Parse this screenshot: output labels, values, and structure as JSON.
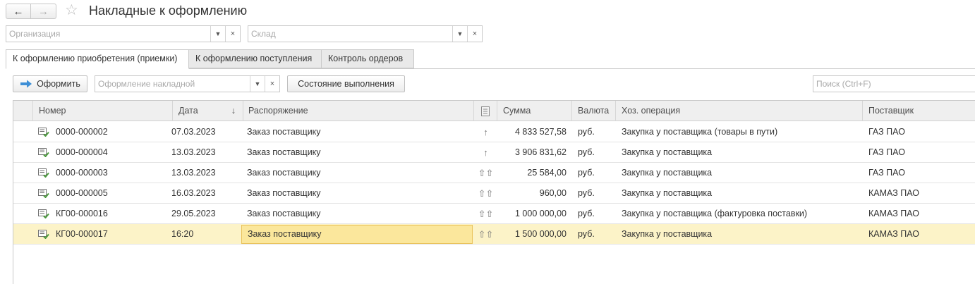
{
  "window": {
    "title": "Накладные к оформлению"
  },
  "nav": {
    "back_icon": "arrow-left-icon",
    "forward_icon": "arrow-right-icon",
    "favorite_icon": "star-icon"
  },
  "filters": {
    "organization": {
      "placeholder": "Организация",
      "value": ""
    },
    "warehouse": {
      "placeholder": "Склад",
      "value": ""
    }
  },
  "tabs": [
    {
      "label": "К оформлению приобретения (приемки)",
      "active": true
    },
    {
      "label": "К оформлению поступления",
      "active": false
    },
    {
      "label": "Контроль ордеров",
      "active": false
    }
  ],
  "toolbar": {
    "process_label": "Оформить",
    "process_icon": "arrow-right-icon",
    "processing_placeholder": "Оформление накладной",
    "status_label": "Состояние выполнения",
    "search_placeholder": "Поиск (Ctrl+F)"
  },
  "table": {
    "columns": [
      "Номер",
      "Дата",
      "Распоряжение",
      "",
      "Сумма",
      "Валюта",
      "Хоз. операция",
      "Поставщик"
    ],
    "sort_indicator": "↓",
    "rows": [
      {
        "number": "0000-000002",
        "date": "07.03.2023",
        "order": "Заказ поставщику",
        "arrow": "↑",
        "sum": "4 833 527,58",
        "currency": "руб.",
        "operation": "Закупка у поставщика (товары в пути)",
        "supplier": "ГАЗ ПАО"
      },
      {
        "number": "0000-000004",
        "date": "13.03.2023",
        "order": "Заказ поставщику",
        "arrow": "↑",
        "sum": "3 906 831,62",
        "currency": "руб.",
        "operation": "Закупка у поставщика",
        "supplier": "ГАЗ ПАО"
      },
      {
        "number": "0000-000003",
        "date": "13.03.2023",
        "order": "Заказ поставщику",
        "arrow": "⇧⇧",
        "sum": "25 584,00",
        "currency": "руб.",
        "operation": "Закупка у поставщика",
        "supplier": "ГАЗ ПАО"
      },
      {
        "number": "0000-000005",
        "date": "16.03.2023",
        "order": "Заказ поставщику",
        "arrow": "⇧⇧",
        "sum": "960,00",
        "currency": "руб.",
        "operation": "Закупка у поставщика",
        "supplier": "КАМАЗ ПАО"
      },
      {
        "number": "КГ00-000016",
        "date": "29.05.2023",
        "order": "Заказ поставщику",
        "arrow": "⇧⇧",
        "sum": "1 000 000,00",
        "currency": "руб.",
        "operation": "Закупка у поставщика (фактуровка поставки)",
        "supplier": "КАМАЗ ПАО"
      },
      {
        "number": "КГ00-000017",
        "date": "16:20",
        "order": "Заказ поставщику",
        "arrow": "⇧⇧",
        "sum": "1 500 000,00",
        "currency": "руб.",
        "operation": "Закупка у поставщика",
        "supplier": "КАМАЗ ПАО",
        "selected": true
      }
    ]
  },
  "colors": {
    "accent": "#3e8fd6",
    "selected_row": "#fcf3c8",
    "selected_cell": "#fbe79c",
    "doc_icon": "#4a9a3c"
  }
}
